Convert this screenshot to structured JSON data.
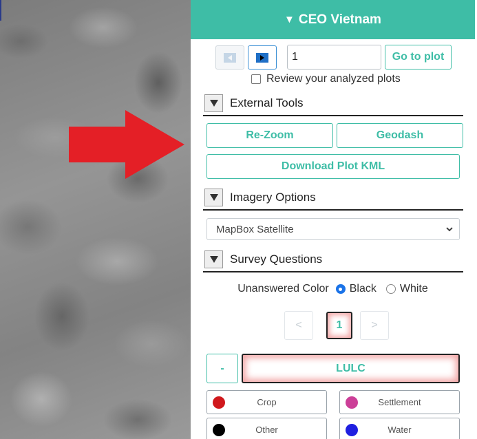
{
  "header": {
    "title": "CEO Vietnam",
    "caret": "▼"
  },
  "navigation": {
    "plot_input_value": "1",
    "go_to_plot_label": "Go to plot",
    "review_label": "Review your analyzed plots"
  },
  "external_tools": {
    "title": "External Tools",
    "rezoom_label": "Re-Zoom",
    "geodash_label": "Geodash",
    "download_kml_label": "Download Plot KML"
  },
  "imagery_options": {
    "title": "Imagery Options",
    "selected": "MapBox Satellite"
  },
  "survey_questions": {
    "title": "Survey Questions",
    "unanswered_color_label": "Unanswered Color",
    "color_options": [
      "Black",
      "White"
    ],
    "selected_color": "Black",
    "pager": {
      "prev": "<",
      "current": "1",
      "next": ">"
    },
    "collapse_label": "-",
    "question_label": "LULC",
    "answers": [
      {
        "label": "Crop",
        "color": "#d0181c"
      },
      {
        "label": "Settlement",
        "color": "#cc3f98"
      },
      {
        "label": "Other",
        "color": "#000000"
      },
      {
        "label": "Water",
        "color": "#1f1fe0"
      }
    ]
  },
  "colors": {
    "accent": "#3ebda6",
    "arrow": "#e41f26"
  }
}
